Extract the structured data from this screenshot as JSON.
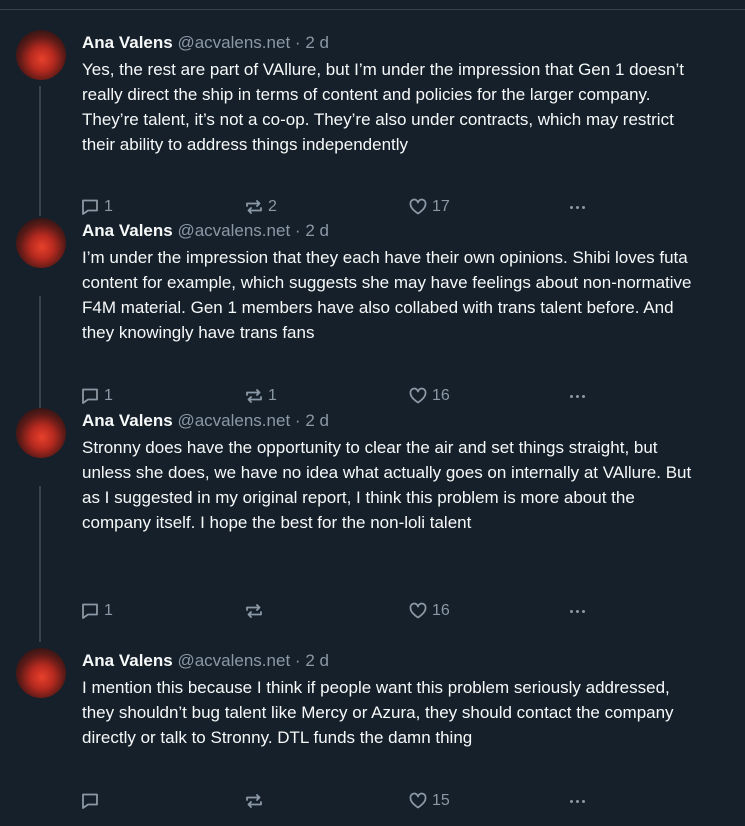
{
  "tweets": [
    {
      "name": "Ana Valens",
      "handle": "@acvalens.net",
      "separator": "·",
      "time": "2 d",
      "text": "Yes, the rest are part of VAllure, but I’m under the impression that Gen 1 doesn’t really direct the ship in terms of content and policies for the larger company. They’re talent, it’s not a co-op. They’re also under contracts, which may restrict their ability to address things independently",
      "replies": "1",
      "reposts": "2",
      "likes": "17"
    },
    {
      "name": "Ana Valens",
      "handle": "@acvalens.net",
      "separator": "·",
      "time": "2 d",
      "text": "I’m under the impression that they each have their own opinions. Shibi loves futa content for example, which suggests she may have feelings about non-normative F4M material. Gen 1 members have also collabed with trans talent before. And they knowingly have trans fans",
      "replies": "1",
      "reposts": "1",
      "likes": "16"
    },
    {
      "name": "Ana Valens",
      "handle": "@acvalens.net",
      "separator": "·",
      "time": "2 d",
      "text": "Stronny does have the opportunity to clear the air and set things straight, but unless she does, we have no idea what actually goes on internally at VAllure. But as I suggested in my original report, I think this problem is more about the company itself. I hope the best for the non-loli talent",
      "replies": "1",
      "reposts": "",
      "likes": "16"
    },
    {
      "name": "Ana Valens",
      "handle": "@acvalens.net",
      "separator": "·",
      "time": "2 d",
      "text": "I mention this because I think if people want this problem seriously addressed, they shouldn’t bug talent like Mercy or Azura, they should contact the company directly or talk to Stronny. DTL funds the damn thing",
      "replies": "",
      "reposts": "",
      "likes": "15"
    }
  ],
  "icons": {
    "reply": "reply-icon",
    "repost": "repost-icon",
    "like": "heart-icon",
    "more": "more-icon"
  },
  "colors": {
    "background": "#15202b",
    "text": "#f7f9f9",
    "muted": "#8b98a5",
    "divider": "#38444d"
  }
}
